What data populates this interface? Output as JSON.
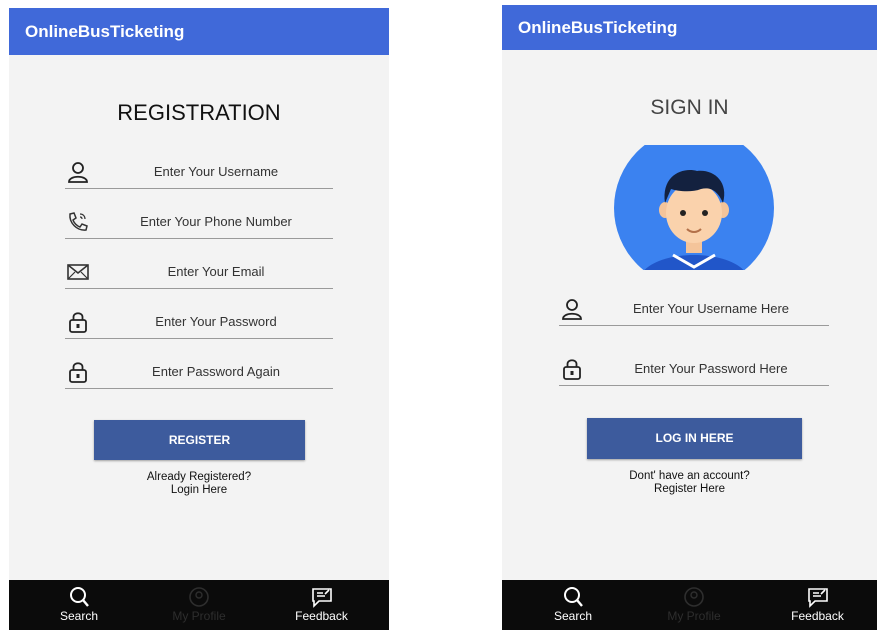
{
  "app": {
    "title": "OnlineBusTicketing"
  },
  "registration": {
    "heading": "REGISTRATION",
    "fields": [
      {
        "icon": "user-icon",
        "placeholder": "Enter Your Username"
      },
      {
        "icon": "phone-icon",
        "placeholder": "Enter Your Phone Number"
      },
      {
        "icon": "email-icon",
        "placeholder": "Enter Your Email"
      },
      {
        "icon": "lock-icon",
        "placeholder": "Enter Your Password"
      },
      {
        "icon": "lock-icon",
        "placeholder": "Enter Password Again"
      }
    ],
    "button": "REGISTER",
    "prompt_line1": "Already Registered?",
    "prompt_line2": "Login Here"
  },
  "signin": {
    "heading": "SIGN IN",
    "avatar": "avatar-boy-illustration",
    "fields": [
      {
        "icon": "user-icon",
        "placeholder": "Enter Your Username Here"
      },
      {
        "icon": "lock-icon",
        "placeholder": "Enter Your Password Here"
      }
    ],
    "button": "LOG IN HERE",
    "prompt_line1": "Dont' have an account?",
    "prompt_line2": "Register Here"
  },
  "bottom_nav": [
    {
      "label": "Search",
      "icon": "search-icon",
      "active": true
    },
    {
      "label": "My Profile",
      "icon": "profile-icon",
      "active": false
    },
    {
      "label": "Feedback",
      "icon": "feedback-icon",
      "active": true
    }
  ],
  "colors": {
    "appbar": "#4069d9",
    "button": "#3d5b9d",
    "background": "#f3f3f3",
    "nav": "#0b0b0b"
  }
}
